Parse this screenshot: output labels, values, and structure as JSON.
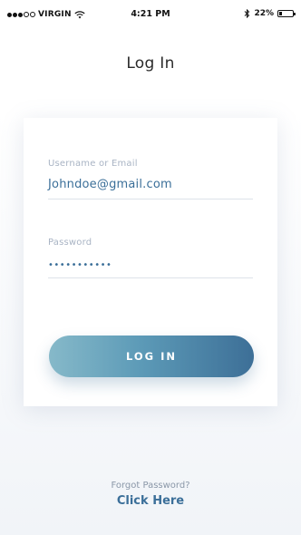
{
  "status_bar": {
    "carrier": "VIRGIN",
    "time": "4:21 PM",
    "battery_text": "22%",
    "battery_level": 0.22,
    "signal_icon": "signal-dots-icon",
    "wifi_icon": "wifi-icon",
    "bluetooth_icon": "bluetooth-icon",
    "battery_icon": "battery-icon"
  },
  "page": {
    "title": "Log In"
  },
  "form": {
    "username": {
      "label": "Username or Email",
      "value": "Johndoe@gmail.com"
    },
    "password": {
      "label": "Password",
      "value": "•••••••••••"
    },
    "login_button_label": "LOG IN"
  },
  "footer": {
    "forgot_text": "Forgot Password?",
    "link_text": "Click Here"
  },
  "colors": {
    "accent": "#3b6f99",
    "button_gradient_start": "#86b9c9",
    "button_gradient_end": "#3d6f97",
    "label": "#a9b4c4"
  }
}
